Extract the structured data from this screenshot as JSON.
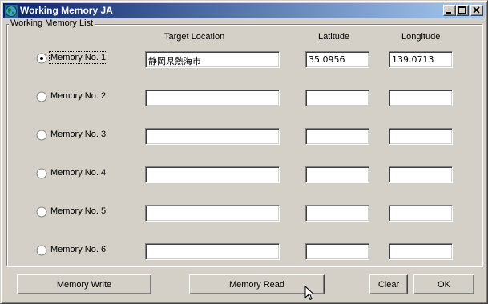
{
  "window": {
    "title": "Working Memory JA",
    "icon": "globe-app-icon",
    "controls": [
      "minimize-icon",
      "maximize-icon",
      "close-icon"
    ]
  },
  "group": {
    "label": "Working Memory List"
  },
  "headers": {
    "target_location": "Target Location",
    "latitude": "Latitude",
    "longitude": "Longitude"
  },
  "rows": [
    {
      "label": "Memory No. 1",
      "selected": true,
      "location": "静岡県熱海市",
      "latitude": "35.0956",
      "longitude": "139.0713"
    },
    {
      "label": "Memory No. 2",
      "selected": false,
      "location": "",
      "latitude": "",
      "longitude": ""
    },
    {
      "label": "Memory No. 3",
      "selected": false,
      "location": "",
      "latitude": "",
      "longitude": ""
    },
    {
      "label": "Memory No. 4",
      "selected": false,
      "location": "",
      "latitude": "",
      "longitude": ""
    },
    {
      "label": "Memory No. 5",
      "selected": false,
      "location": "",
      "latitude": "",
      "longitude": ""
    },
    {
      "label": "Memory No. 6",
      "selected": false,
      "location": "",
      "latitude": "",
      "longitude": ""
    }
  ],
  "buttons": {
    "memory_write": "Memory Write",
    "memory_read": "Memory Read",
    "clear": "Clear",
    "ok": "OK"
  }
}
